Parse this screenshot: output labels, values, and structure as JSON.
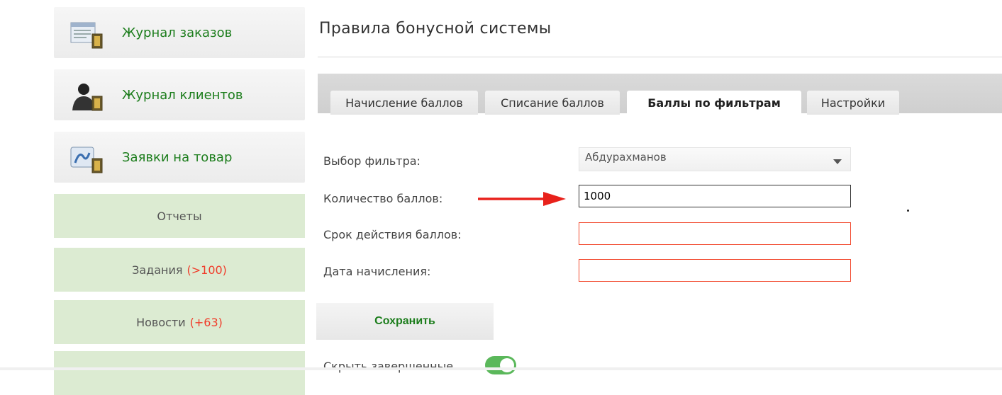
{
  "sidebar": {
    "big_items": [
      {
        "label": "Журнал заказов",
        "icon": "order-journal-icon"
      },
      {
        "label": "Журнал клиентов",
        "icon": "clients-icon"
      },
      {
        "label": "Заявки на товар",
        "icon": "product-requests-icon"
      }
    ],
    "reports": "Отчеты",
    "tasks": {
      "label": "Задания",
      "badge": "(>100)"
    },
    "news": {
      "label": "Новости",
      "badge": "(+63)"
    }
  },
  "main": {
    "title": "Правила бонусной системы",
    "tabs": [
      {
        "label": "Начисление баллов",
        "active": false
      },
      {
        "label": "Списание баллов",
        "active": false
      },
      {
        "label": "Баллы по фильтрам",
        "active": true
      },
      {
        "label": "Настройки",
        "active": false
      }
    ],
    "form": {
      "filter_label": "Выбор фильтра:",
      "filter_value": "Абдурахманов",
      "points_label": "Количество баллов:",
      "points_value": "1000",
      "validity_label": "Срок действия баллов:",
      "validity_value": "",
      "date_label": "Дата начисления:",
      "date_value": ""
    },
    "save_button": "Сохранить",
    "hide_completed": "Скрыть завершенные"
  },
  "colors": {
    "accent_green": "#1c7d1c",
    "sidebar_green": "#dcebd2",
    "badge_red": "#f03c2a",
    "error_border": "#f24a2f",
    "arrow_red": "#e8211b"
  }
}
